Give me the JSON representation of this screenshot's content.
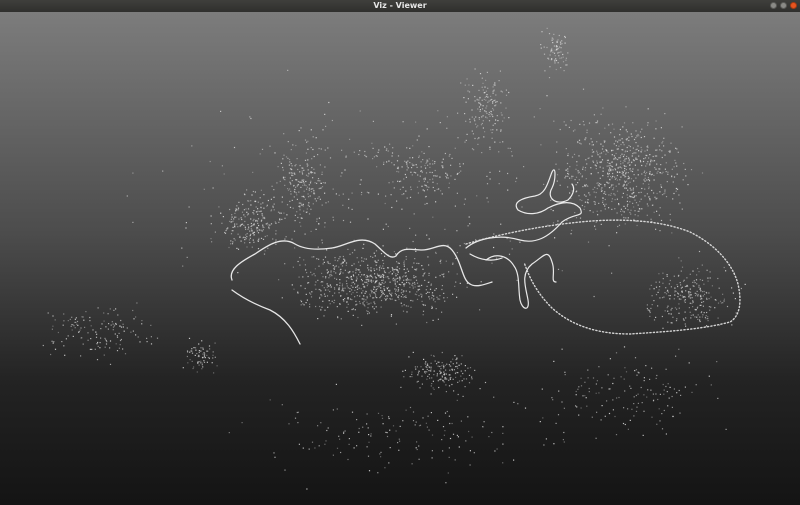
{
  "window": {
    "title": "Viz - Viewer",
    "controls": [
      "minimize",
      "maximize",
      "close"
    ]
  },
  "colors": {
    "titlebar": "#353532",
    "viewport_top": "#7c7c7c",
    "viewport_bottom": "#141414",
    "close_button": "#e8541f",
    "points": "#dcdcdc"
  },
  "icons": {
    "minimize": "minimize-icon",
    "maximize": "maximize-icon",
    "close": "close-icon"
  }
}
